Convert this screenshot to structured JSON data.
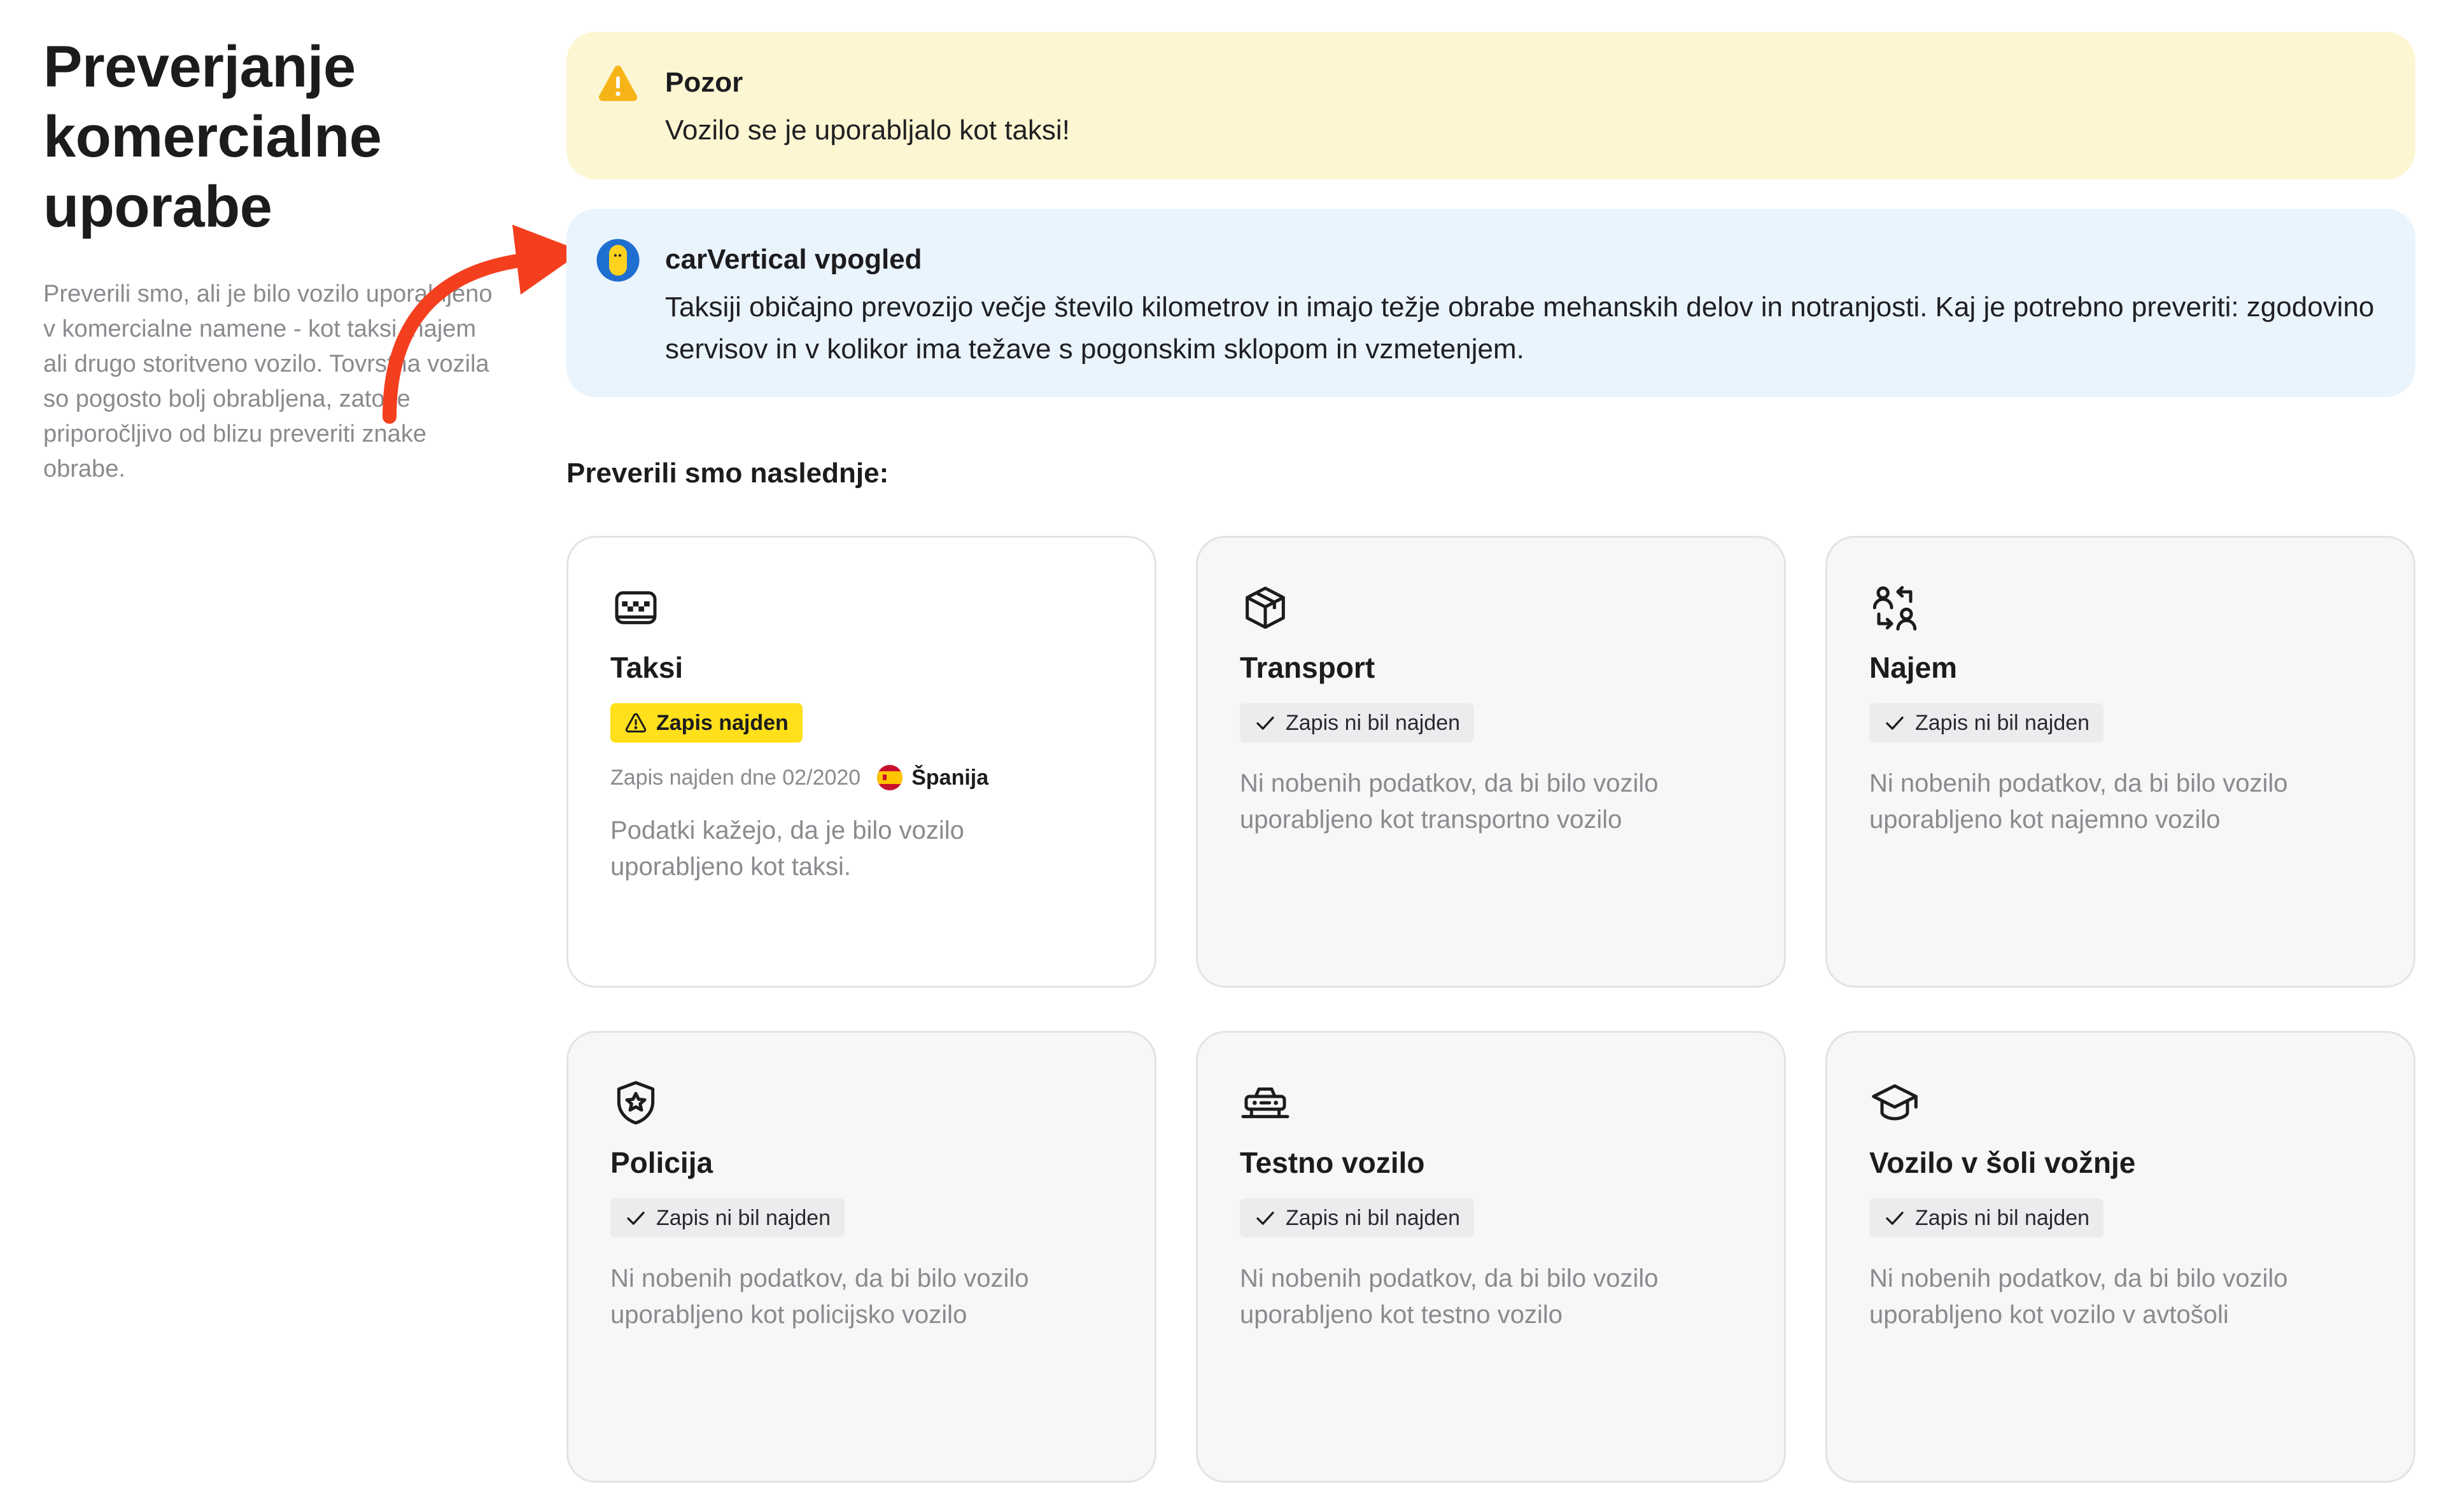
{
  "sidebar": {
    "title": "Preverjanje komercialne uporabe",
    "description": "Preverili smo, ali je bilo vozilo uporabljeno v komercialne namene - kot taksi, najem ali drugo storitveno vozilo. Tovrstna vozila so pogosto bolj obrabljena, zato je priporočljivo od blizu preveriti znake obrabe."
  },
  "warning": {
    "icon": "warning-triangle-icon",
    "title": "Pozor",
    "text": "Vozilo se je uporabljalo kot taksi!",
    "color": "#fdf6d2"
  },
  "insight": {
    "icon": "carvertical-logo-icon",
    "title": "carVertical vpogled",
    "text": "Taksiji običajno prevozijo večje število kilometrov in imajo težje obrabe mehanskih delov in notranjosti. Kaj je potrebno preveriti: zgodovino servisov in v kolikor ima težave s pogonskim sklopom in vzmetenjem.",
    "color": "#eaf4fd"
  },
  "checks": {
    "heading": "Preverili smo naslednje:",
    "items": [
      {
        "icon": "taxi-icon",
        "title": "Taksi",
        "status": "Zapis najden",
        "status_icon": "warning-triangle-icon",
        "record": "Zapis najden dne 02/2020",
        "country": "Španija",
        "country_icon": "spain-flag-icon",
        "description": "Podatki kažejo, da je bilo vozilo uporabljeno kot taksi."
      },
      {
        "icon": "box-icon",
        "title": "Transport",
        "status": "Zapis ni bil najden",
        "status_icon": "checkmark-icon",
        "description": "Ni nobenih podatkov, da bi bilo vozilo uporabljeno kot transportno vozilo"
      },
      {
        "icon": "user-swap-icon",
        "title": "Najem",
        "status": "Zapis ni bil najden",
        "status_icon": "checkmark-icon",
        "description": "Ni nobenih podatkov, da bi bilo vozilo uporabljeno kot najemno vozilo"
      },
      {
        "icon": "police-badge-icon",
        "title": "Policija",
        "status": "Zapis ni bil najden",
        "status_icon": "checkmark-icon",
        "description": "Ni nobenih podatkov, da bi bilo vozilo uporabljeno kot policijsko vozilo"
      },
      {
        "icon": "test-car-icon",
        "title": "Testno vozilo",
        "status": "Zapis ni bil najden",
        "status_icon": "checkmark-icon",
        "description": "Ni nobenih podatkov, da bi bilo vozilo uporabljeno kot testno vozilo"
      },
      {
        "icon": "graduation-cap-icon",
        "title": "Vozilo v šoli vožnje",
        "status": "Zapis ni bil najden",
        "status_icon": "checkmark-icon",
        "description": "Ni nobenih podatkov, da bi bilo vozilo uporabljeno kot vozilo v avtošoli"
      }
    ]
  },
  "colors": {
    "warning_badge": "#ffe01a",
    "annotation_arrow": "#f43f1f"
  }
}
